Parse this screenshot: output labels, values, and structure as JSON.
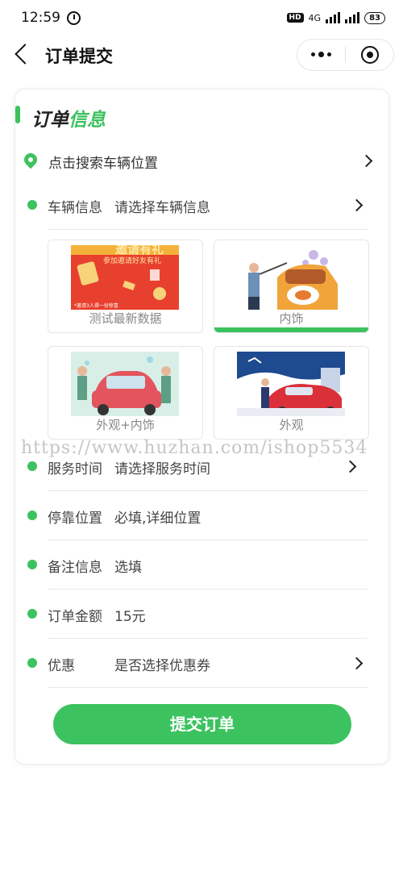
{
  "status_bar": {
    "time": "12:59",
    "network": "4G",
    "battery": "83",
    "hd": "HD"
  },
  "nav": {
    "title": "订单提交"
  },
  "section": {
    "title_part1": "订单",
    "title_part2": "信息"
  },
  "location": {
    "label": "点击搜索车辆位置"
  },
  "vehicle": {
    "label": "车辆信息",
    "value": "请选择车辆信息"
  },
  "services": [
    {
      "name": "测试最新数据",
      "selected": false
    },
    {
      "name": "内饰",
      "selected": true
    },
    {
      "name": "外观+内饰",
      "selected": false
    },
    {
      "name": "外观",
      "selected": false
    }
  ],
  "banner_text": {
    "line1": "邀请有礼",
    "line2": "参加邀请好友有礼",
    "small": "*邀请3人得一份惊喜"
  },
  "service_time": {
    "label": "服务时间",
    "value": "请选择服务时间"
  },
  "parking": {
    "label": "停靠位置",
    "value": "必填,详细位置"
  },
  "remark": {
    "label": "备注信息",
    "value": "选填"
  },
  "amount": {
    "label": "订单金额",
    "value": "15元"
  },
  "discount": {
    "label": "优惠",
    "value": "是否选择优惠券"
  },
  "submit_label": "提交订单",
  "watermark": "https://www.huzhan.com/ishop5534",
  "colors": {
    "accent": "#3cc25f",
    "text": "#333333"
  }
}
